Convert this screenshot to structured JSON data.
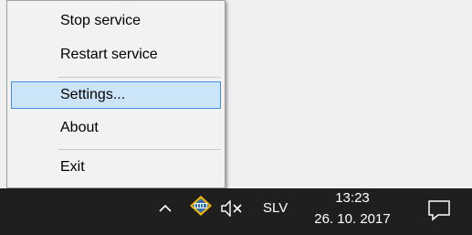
{
  "context_menu": {
    "items": [
      {
        "label": "Stop service"
      },
      {
        "label": "Restart service"
      },
      {
        "label": "Settings..."
      },
      {
        "label": "About"
      },
      {
        "label": "Exit"
      }
    ],
    "selected_item": "Settings...",
    "highlight_color": "#cce4f7",
    "highlight_border_color": "#3d8ee2"
  },
  "taskbar": {
    "background": "#1f1f1f",
    "tray_icons": [
      "chevron-up-icon",
      "imis-app-icon",
      "volume-muted-icon",
      "notification-center-icon"
    ],
    "language": "SLV",
    "clock": {
      "time": "13:23",
      "date": "26. 10. 2017"
    }
  }
}
